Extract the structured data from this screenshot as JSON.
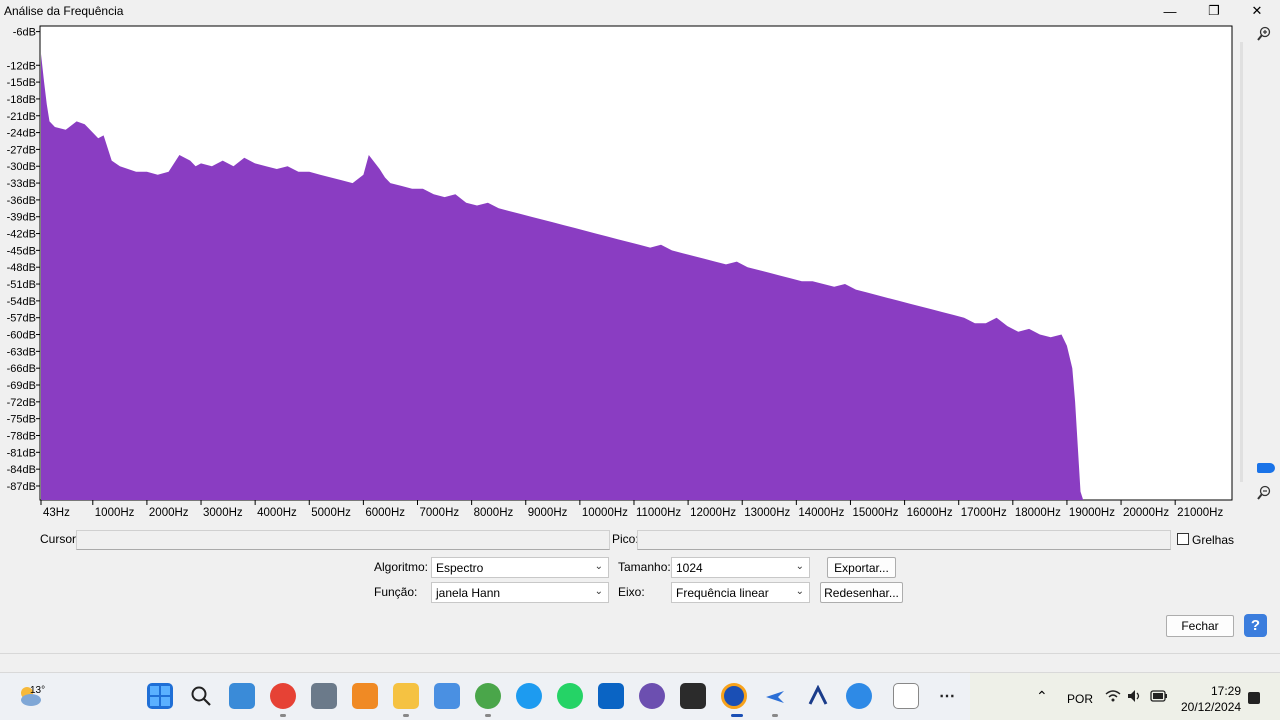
{
  "window": {
    "title": "Análise da Frequência",
    "minimize_label": "—",
    "maximize_label": "❐",
    "close_label": "✕"
  },
  "chart_data": {
    "type": "area",
    "color": "#8a3dc2",
    "y_ticks": [
      "-6dB",
      "-12dB",
      "-15dB",
      "-18dB",
      "-21dB",
      "-24dB",
      "-27dB",
      "-30dB",
      "-33dB",
      "-36dB",
      "-39dB",
      "-42dB",
      "-45dB",
      "-48dB",
      "-51dB",
      "-54dB",
      "-57dB",
      "-60dB",
      "-63dB",
      "-66dB",
      "-69dB",
      "-72dB",
      "-75dB",
      "-78dB",
      "-81dB",
      "-84dB",
      "-87dB"
    ],
    "y_tick_values": [
      -6,
      -12,
      -15,
      -18,
      -21,
      -24,
      -27,
      -30,
      -33,
      -36,
      -39,
      -42,
      -45,
      -48,
      -51,
      -54,
      -57,
      -60,
      -63,
      -66,
      -69,
      -72,
      -75,
      -78,
      -81,
      -84,
      -87
    ],
    "x_ticks": [
      "43Hz",
      "1000Hz",
      "2000Hz",
      "3000Hz",
      "4000Hz",
      "5000Hz",
      "6000Hz",
      "7000Hz",
      "8000Hz",
      "9000Hz",
      "10000Hz",
      "11000Hz",
      "12000Hz",
      "13000Hz",
      "14000Hz",
      "15000Hz",
      "16000Hz",
      "17000Hz",
      "18000Hz",
      "19000Hz",
      "20000Hz",
      "21000Hz"
    ],
    "x_tick_values": [
      43,
      1000,
      2000,
      3000,
      4000,
      5000,
      6000,
      7000,
      8000,
      9000,
      10000,
      11000,
      12000,
      13000,
      14000,
      15000,
      16000,
      17000,
      18000,
      19000,
      20000,
      21000
    ],
    "xlim": [
      43,
      22050
    ],
    "ylim": [
      -89.5,
      -5
    ],
    "x": [
      43,
      100,
      150,
      200,
      300,
      500,
      700,
      850,
      1000,
      1100,
      1200,
      1350,
      1500,
      1650,
      1800,
      2000,
      2200,
      2400,
      2600,
      2800,
      2900,
      3000,
      3200,
      3400,
      3600,
      3800,
      4000,
      4200,
      4400,
      4600,
      4800,
      5000,
      5200,
      5400,
      5600,
      5800,
      6000,
      6100,
      6300,
      6400,
      6500,
      6700,
      6900,
      7100,
      7300,
      7500,
      7700,
      7900,
      8100,
      8300,
      8500,
      8700,
      8900,
      9100,
      9300,
      9500,
      9700,
      9900,
      10100,
      10300,
      10500,
      10700,
      10900,
      11100,
      11300,
      11500,
      11700,
      11900,
      12100,
      12300,
      12500,
      12700,
      12900,
      13100,
      13300,
      13500,
      13700,
      13900,
      14100,
      14300,
      14500,
      14700,
      14900,
      15100,
      15300,
      15500,
      15700,
      15900,
      16100,
      16300,
      16500,
      16700,
      16900,
      17100,
      17300,
      17500,
      17700,
      17900,
      18100,
      18300,
      18500,
      18700,
      18900,
      19000,
      19100,
      19150,
      19200,
      19250,
      19300,
      22050
    ],
    "values": [
      -10,
      -15,
      -19,
      -22,
      -23,
      -23.5,
      -22,
      -22.5,
      -24,
      -25,
      -24.5,
      -29,
      -30,
      -30.5,
      -31,
      -31,
      -31.5,
      -31,
      -28,
      -29,
      -30,
      -29.5,
      -30,
      -29,
      -30,
      -28.5,
      -29.5,
      -30,
      -30.5,
      -30,
      -31,
      -31,
      -31.5,
      -32,
      -32.5,
      -33,
      -31.5,
      -28,
      -30.5,
      -32,
      -33,
      -33.5,
      -34,
      -34,
      -35,
      -35.5,
      -35,
      -36.5,
      -37,
      -36.5,
      -37.5,
      -38,
      -38.5,
      -39,
      -39.5,
      -40,
      -40.5,
      -41,
      -41.5,
      -42,
      -42.5,
      -43,
      -43.5,
      -44,
      -44.5,
      -44,
      -45,
      -45.5,
      -46,
      -46.5,
      -47,
      -47.5,
      -47,
      -48,
      -48.5,
      -49,
      -49.5,
      -50,
      -50.5,
      -50.5,
      -51,
      -51.5,
      -51,
      -52,
      -52.5,
      -53,
      -53.5,
      -54,
      -54.5,
      -55,
      -55.5,
      -56,
      -56.5,
      -57,
      -58,
      -58,
      -57,
      -58.5,
      -59.5,
      -59,
      -60,
      -60.5,
      -60,
      -62,
      -66,
      -72,
      -80,
      -88,
      -89.5,
      -89.5
    ]
  },
  "controls": {
    "cursor_label": "Cursor:",
    "cursor_value": "",
    "peak_label": "Pico:",
    "peak_value": "",
    "grid_label": "Grelhas",
    "algorithm_label": "Algoritmo:",
    "algorithm_value": "Espectro",
    "function_label": "Função:",
    "function_value": "janela Hann",
    "size_label": "Tamanho:",
    "size_value": "1024",
    "axis_label": "Eixo:",
    "axis_value": "Frequência linear",
    "export_label": "Exportar...",
    "redraw_label": "Redesenhar...",
    "close_label": "Fechar",
    "help_label": "?"
  },
  "taskbar": {
    "weather_temp": "13°",
    "language": "POR",
    "time": "17:29",
    "date": "20/12/2024"
  }
}
